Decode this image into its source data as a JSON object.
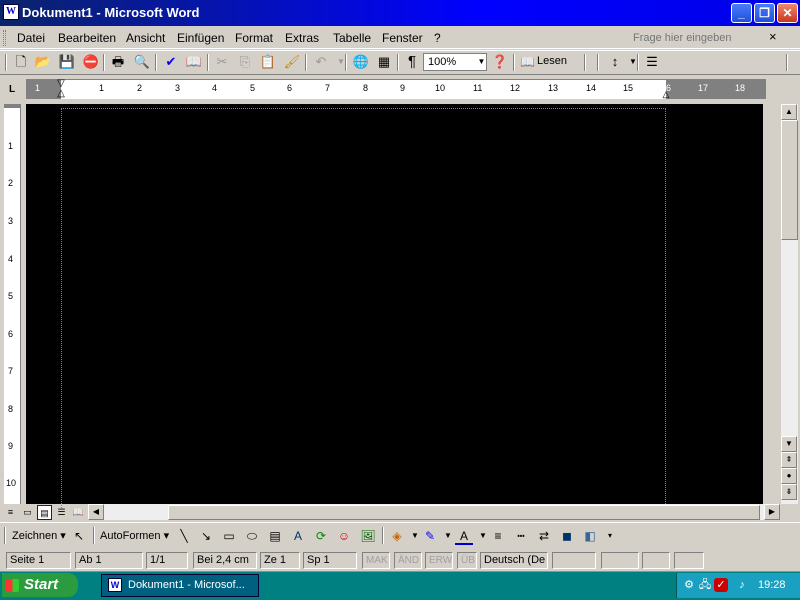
{
  "window": {
    "title": "Dokument1 - Microsoft Word",
    "icon": "W",
    "min": "_",
    "max": "❐",
    "close": "✕"
  },
  "menu": {
    "items": [
      "Datei",
      "Bearbeiten",
      "Ansicht",
      "Einfügen",
      "Format",
      "Extras",
      "Tabelle",
      "Fenster",
      "?"
    ],
    "help_placeholder": "Frage hier eingeben",
    "close": "×"
  },
  "toolbar": {
    "icons": [
      "new-icon",
      "open-icon",
      "save-icon",
      "permission-icon",
      "print-icon",
      "print-preview-icon",
      "spelling-icon",
      "research-icon",
      "cut-icon",
      "copy-icon",
      "paste-icon",
      "format-painter-icon",
      "undo-icon",
      "hyperlink-icon",
      "table-icon",
      "show-formatting-icon",
      "help-icon",
      "line-spacing-icon",
      "numbering-icon"
    ],
    "zoom": "100%",
    "zoom_arrow": "▼",
    "read_label": "Lesen",
    "paragraph_mark": "¶"
  },
  "ruler": {
    "numbers": [
      "1",
      "1",
      "2",
      "3",
      "4",
      "5",
      "6",
      "7",
      "8",
      "9",
      "10",
      "11",
      "12",
      "13",
      "14",
      "15",
      "16",
      "17",
      "18"
    ],
    "tab_marker": "L"
  },
  "vruler": {
    "numbers": [
      "1",
      "2",
      "3",
      "4",
      "5",
      "6",
      "7",
      "8",
      "9",
      "10"
    ]
  },
  "drawing": {
    "draw_label": "Zeichnen ▾",
    "autoshapes_label": "AutoFormen ▾"
  },
  "status": {
    "page": "Seite  1",
    "section": "Ab  1",
    "pages": "1/1",
    "at": "Bei  2,4 cm",
    "line": "Ze  1",
    "col": "Sp  1",
    "rec": "MAK",
    "trk": "ÄND",
    "ext": "ERW",
    "ovr": "ÜB",
    "language": "Deutsch (De"
  },
  "taskbar": {
    "start": "Start",
    "task_word": "Dokument1 - Microsof...",
    "clock": "19:28"
  }
}
